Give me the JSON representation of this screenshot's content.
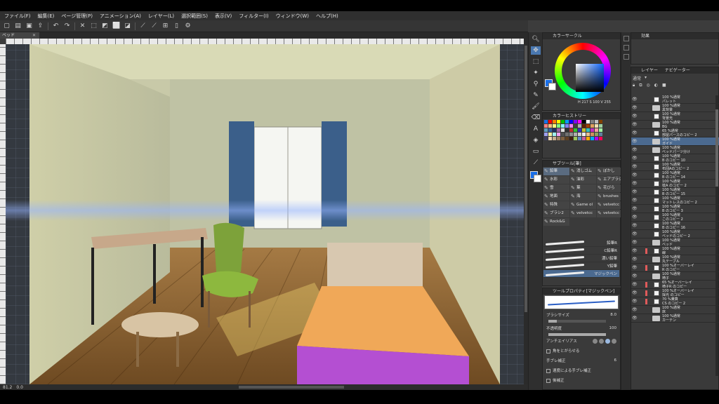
{
  "menu": [
    "ファイル(F)",
    "編集(E)",
    "ページ管理(P)",
    "アニメーション(A)",
    "レイヤー(L)",
    "選択範囲(S)",
    "表示(V)",
    "フィルター(I)",
    "ウィンドウ(W)",
    "ヘルプ(H)"
  ],
  "canvas": {
    "doc_tab": "ベッド",
    "statusbar": [
      "81.2",
      "0.0"
    ]
  },
  "color_wheel": {
    "title": "カラーサークル",
    "values": "H 217  S 100  V 255"
  },
  "color_history": {
    "title": "カラーヒストリー"
  },
  "subtool": {
    "title": "サブツール[筆]",
    "categories": [
      "鉛筆",
      "消しゴム",
      "ぼかし",
      "水彩",
      "油彩",
      "エアブラシ",
      "雪",
      "葉",
      "花びら",
      "地面",
      "海",
      "brushes",
      "特殊",
      "Game ol",
      "velvetcc",
      "ブラシ2",
      "velvetcc",
      "velvetcc",
      "Rock&G"
    ],
    "brushes": [
      "鉛筆R",
      "C鉛筆R",
      "濃い鉛筆",
      "Y鉛筆",
      "マジックペン"
    ]
  },
  "tool_property": {
    "title": "ツールプロパティ[マジックペン]",
    "preview_label": "マジックペン",
    "brush_size_label": "ブラシサイズ",
    "brush_size_value": "8.0",
    "opacity_label": "不透明度",
    "opacity_value": "100",
    "antialias_label": "アンチエイリアス",
    "corner_label": "角をとがらせる",
    "stabilize_label": "手ブレ補正",
    "stabilize_value": "6",
    "speed_label": "速度による手ブレ補正",
    "postcorrect_label": "後補正"
  },
  "effect_panel": {
    "title": "効果"
  },
  "layer_panel": {
    "tabs": [
      "レイヤー",
      "ナビゲーター"
    ],
    "blend_mode": "通常",
    "layers": [
      {
        "line1": "100 %通常",
        "line2": "パレット",
        "kind": "thumb"
      },
      {
        "line1": "100 %通常",
        "line2": "黒背景",
        "kind": "folder"
      },
      {
        "line1": "100 %通常",
        "line2": "背景光",
        "kind": "thumb"
      },
      {
        "line1": "100 %通常",
        "line2": "BG",
        "kind": "folder"
      },
      {
        "line1": "65 %通常",
        "line2": "部屋パースのコピー 2",
        "kind": "thumb"
      },
      {
        "line1": "100 %通常",
        "line2": "ガイド",
        "kind": "folder",
        "selected": true
      },
      {
        "line1": "100 %通常",
        "line2": "ベッドパーツ分け",
        "kind": "folder"
      },
      {
        "line1": "100 %通常",
        "line2": "B のコピー 10",
        "kind": "thumb"
      },
      {
        "line1": "100 %通常",
        "line2": "布団Aのコピー 2",
        "kind": "thumb"
      },
      {
        "line1": "100 %通常",
        "line2": "B のコピー 14",
        "kind": "thumb"
      },
      {
        "line1": "100 %通常",
        "line2": "枕A のコピー 2",
        "kind": "thumb"
      },
      {
        "line1": "100 %通常",
        "line2": "B のコピー 15",
        "kind": "thumb"
      },
      {
        "line1": "100 %通常",
        "line2": "マットレスのコピー 2",
        "kind": "thumb"
      },
      {
        "line1": "100 %通常",
        "line2": "B のコピー 3",
        "kind": "thumb"
      },
      {
        "line1": "100 %通常",
        "line2": "このコピー 2",
        "kind": "thumb"
      },
      {
        "line1": "100 %通常",
        "line2": "B のコピー 16",
        "kind": "thumb"
      },
      {
        "line1": "100 %通常",
        "line2": "ベッドのコピー 2",
        "kind": "thumb"
      },
      {
        "line1": "100 %通常",
        "line2": "ベッド",
        "kind": "folder"
      },
      {
        "line1": "100 %通常",
        "line2": "線",
        "kind": "thumb",
        "mark": true
      },
      {
        "line1": "100 %通常",
        "line2": "丸テーブル",
        "kind": "folder"
      },
      {
        "line1": "100 %オーバーレイ",
        "line2": "R のコピー",
        "kind": "thumb",
        "mark": true
      },
      {
        "line1": "100 %通常",
        "line2": "椅子",
        "kind": "folder"
      },
      {
        "line1": "65 %オーバーレイ",
        "line2": "椅子R のコピー",
        "kind": "thumb",
        "mark": true
      },
      {
        "line1": "100 %オーバーレイ",
        "line2": "採光 のコピー",
        "kind": "thumb",
        "mark": true
      },
      {
        "line1": "70 %乗算",
        "line2": "CS のコピー 2",
        "kind": "thumb",
        "mark": true
      },
      {
        "line1": "100 %通常",
        "line2": "床",
        "kind": "folder"
      },
      {
        "line1": "100 %通常",
        "line2": "カーテン",
        "kind": "folder"
      }
    ]
  },
  "colors": {
    "main": "#1a6fe8",
    "sub": "#ffffff",
    "history": [
      "#1a6fe8",
      "#ff0000",
      "#ff7f00",
      "#ffff00",
      "#00c000",
      "#00a0ff",
      "#0000ff",
      "#8000ff",
      "#ff00ff",
      "#000000",
      "#ffffff",
      "#808080",
      "#c0c0c0",
      "#804000",
      "#ff8080",
      "#ffc080",
      "#ffff80",
      "#80ff80",
      "#80ffff",
      "#8080ff",
      "#ff80ff",
      "#404040",
      "#b0b0b0",
      "#602000",
      "#a04000",
      "#e0a060",
      "#f0e0b0",
      "#a0d0a0",
      "#60a0c0",
      "#3060a0",
      "#203060",
      "#a060a0",
      "#e0e0e0",
      "#303030",
      "#c03030",
      "#30c030",
      "#3030c0",
      "#c0c030",
      "#30c0c0",
      "#c030c0",
      "#f0a0a0",
      "#a0f0a0",
      "#a0a0f0",
      "#f0f0a0",
      "#a0f0f0",
      "#f0a0f0",
      "#505050",
      "#707070",
      "#909090",
      "#b0b0b0",
      "#d0d0d0",
      "#f0f0f0",
      "#e8c090",
      "#d09060",
      "#8fa060",
      "#6080a0",
      "#404060",
      "#f2d6b3",
      "#c8b090",
      "#a08060",
      "#806040",
      "#604020",
      "#402010",
      "#9cc85c",
      "#5c8cc8",
      "#c85c9c",
      "#ffaa00",
      "#00aaff",
      "#aa00ff",
      "#ff0055"
    ]
  }
}
